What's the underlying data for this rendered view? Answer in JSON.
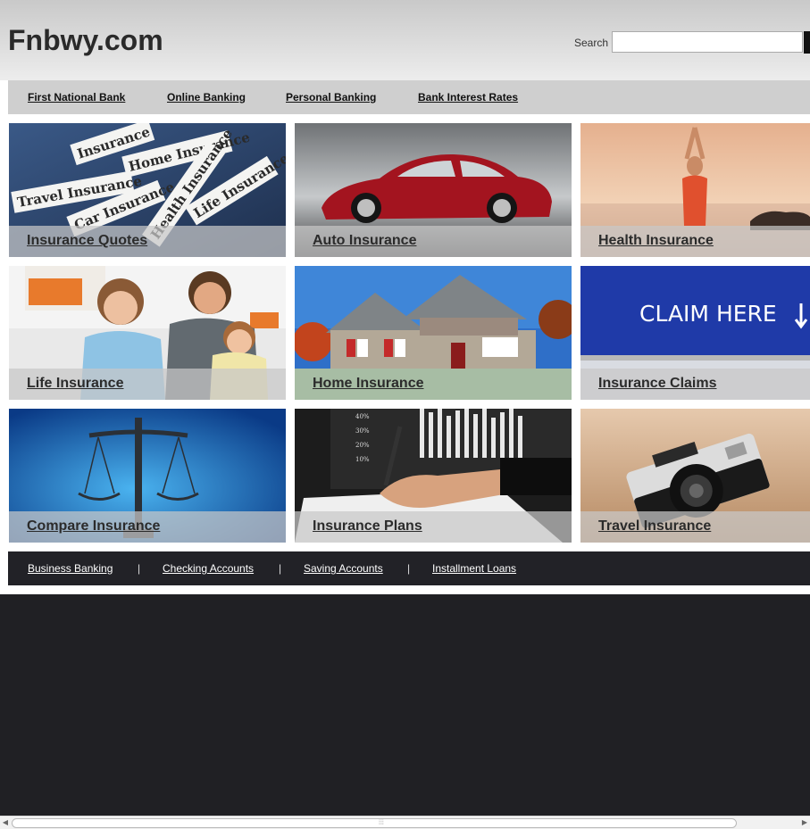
{
  "site": {
    "logo": "Fnbwy.com"
  },
  "search": {
    "label": "Search",
    "value": "",
    "placeholder": ""
  },
  "topnav": {
    "items": [
      {
        "label": "First National Bank"
      },
      {
        "label": "Online Banking"
      },
      {
        "label": "Personal Banking"
      },
      {
        "label": "Bank Interest Rates"
      }
    ]
  },
  "tiles": [
    {
      "label": "Insurance Quotes",
      "image": "insurance-papers-image",
      "paper_texts": [
        "Insurance",
        "Home Insurance",
        "Travel Insurance",
        "Car Insurance",
        "Health Insurance",
        "Life Insurance"
      ]
    },
    {
      "label": "Auto Insurance",
      "image": "red-car-image"
    },
    {
      "label": "Health Insurance",
      "image": "yoga-woman-image"
    },
    {
      "label": "Life Insurance",
      "image": "family-image"
    },
    {
      "label": "Home Insurance",
      "image": "house-image"
    },
    {
      "label": "Insurance Claims",
      "image": "claim-sign-image",
      "sign_text": "CLAIM HERE"
    },
    {
      "label": "Compare Insurance",
      "image": "scales-image"
    },
    {
      "label": "Insurance Plans",
      "image": "chart-pen-image",
      "chart_ticks": [
        "40%",
        "30%",
        "20%",
        "10%"
      ]
    },
    {
      "label": "Travel Insurance",
      "image": "camera-image"
    }
  ],
  "footnav": {
    "items": [
      {
        "label": "Business Banking"
      },
      {
        "label": "Checking Accounts"
      },
      {
        "label": "Saving Accounts"
      },
      {
        "label": "Installment Loans"
      }
    ],
    "separator": "|"
  },
  "colors": {
    "footer_bg": "#222227",
    "caption_overlay": "rgba(200,200,200,0.72)",
    "nav_bg": "#cfcfcf"
  }
}
